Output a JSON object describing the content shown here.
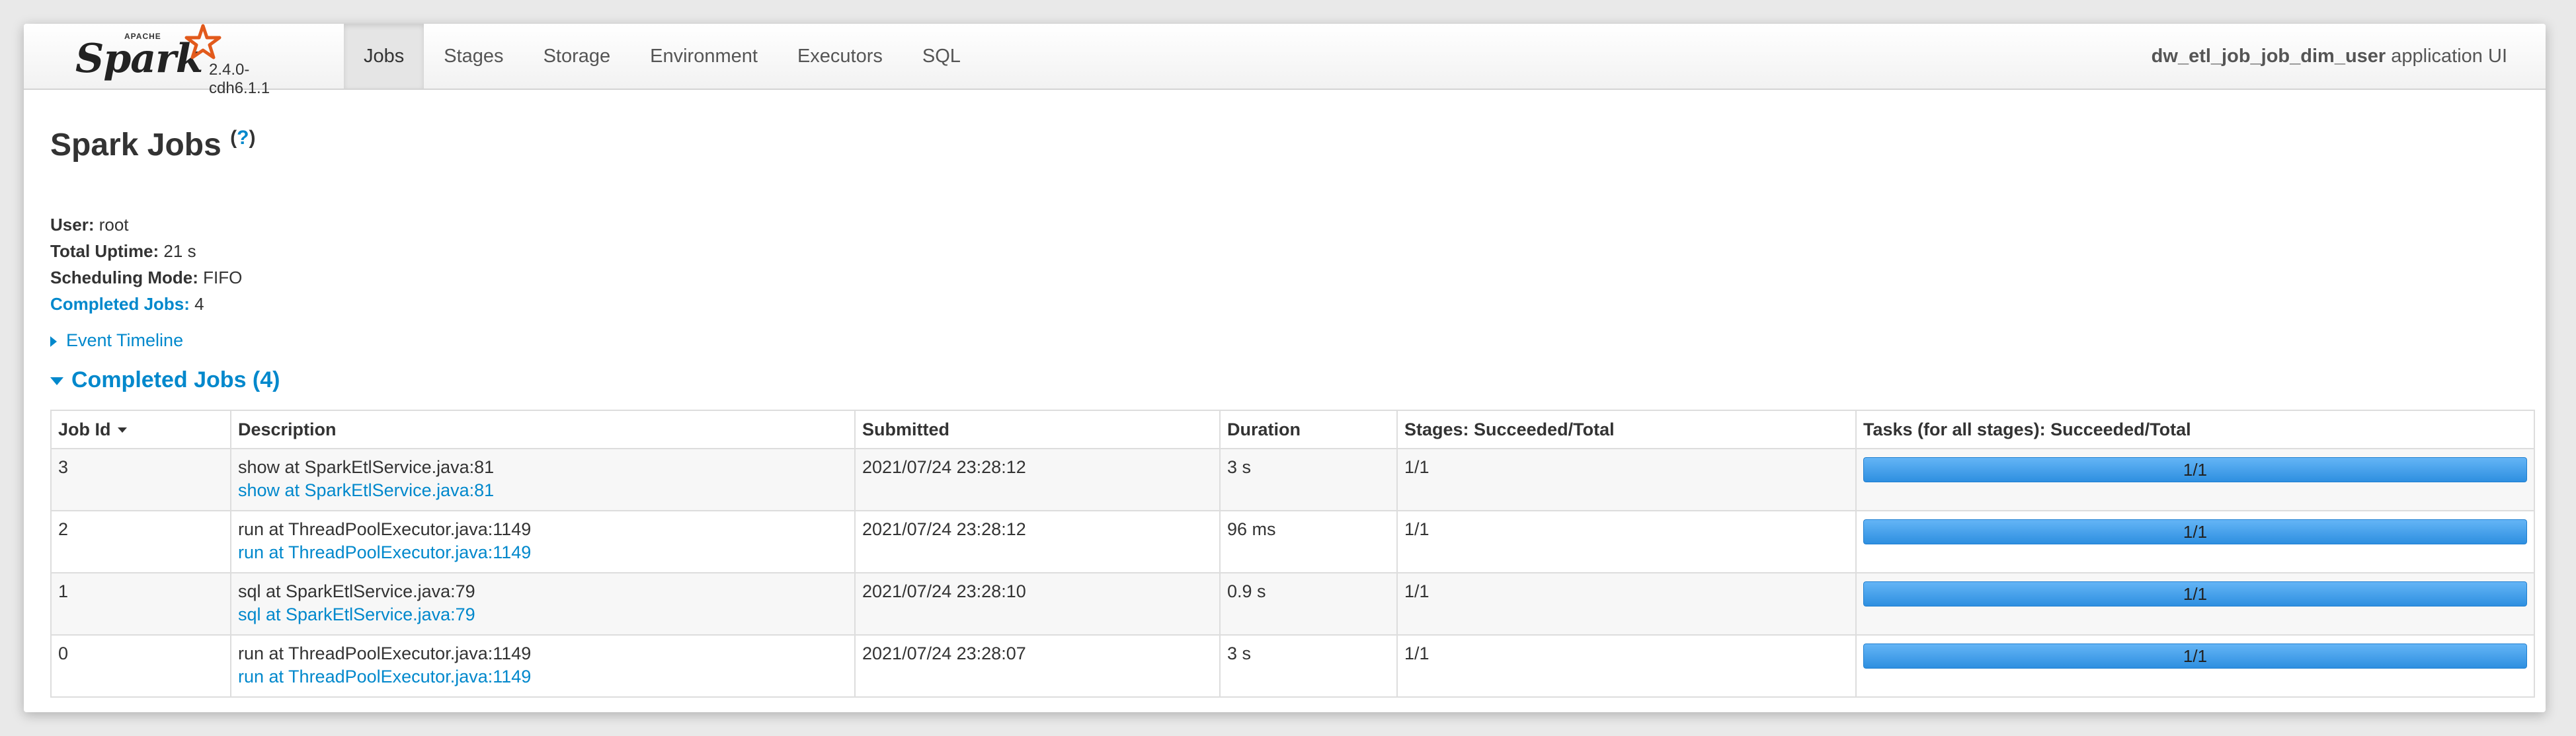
{
  "brand": {
    "name": "Spark",
    "apache": "APACHE",
    "version": "2.4.0-cdh6.1.1"
  },
  "nav": {
    "tabs": [
      {
        "label": "Jobs",
        "active": true
      },
      {
        "label": "Stages"
      },
      {
        "label": "Storage"
      },
      {
        "label": "Environment"
      },
      {
        "label": "Executors"
      },
      {
        "label": "SQL"
      }
    ],
    "app_name": "dw_etl_job_job_dim_user",
    "app_suffix": "application UI"
  },
  "page": {
    "title": "Spark Jobs",
    "help": "?"
  },
  "summary": {
    "user_label": "User:",
    "user": "root",
    "uptime_label": "Total Uptime:",
    "uptime": "21 s",
    "mode_label": "Scheduling Mode:",
    "mode": "FIFO",
    "completed_label": "Completed Jobs:",
    "completed": "4"
  },
  "timeline": {
    "label": "Event Timeline"
  },
  "completed_jobs": {
    "header": "Completed Jobs (4)",
    "columns": [
      "Job Id",
      "Description",
      "Submitted",
      "Duration",
      "Stages: Succeeded/Total",
      "Tasks (for all stages): Succeeded/Total"
    ],
    "rows": [
      {
        "id": "3",
        "desc": "show at SparkEtlService.java:81",
        "link": "show at SparkEtlService.java:81",
        "submitted": "2021/07/24 23:28:12",
        "duration": "3 s",
        "stages": "1/1",
        "tasks": "1/1",
        "progress": 1.0
      },
      {
        "id": "2",
        "desc": "run at ThreadPoolExecutor.java:1149",
        "link": "run at ThreadPoolExecutor.java:1149",
        "submitted": "2021/07/24 23:28:12",
        "duration": "96 ms",
        "stages": "1/1",
        "tasks": "1/1",
        "progress": 1.0
      },
      {
        "id": "1",
        "desc": "sql at SparkEtlService.java:79",
        "link": "sql at SparkEtlService.java:79",
        "submitted": "2021/07/24 23:28:10",
        "duration": "0.9 s",
        "stages": "1/1",
        "tasks": "1/1",
        "progress": 1.0
      },
      {
        "id": "0",
        "desc": "run at ThreadPoolExecutor.java:1149",
        "link": "run at ThreadPoolExecutor.java:1149",
        "submitted": "2021/07/24 23:28:07",
        "duration": "3 s",
        "stages": "1/1",
        "tasks": "1/1",
        "progress": 1.0
      }
    ]
  },
  "colors": {
    "link": "#0088cc",
    "progress": "#3a97e6"
  }
}
